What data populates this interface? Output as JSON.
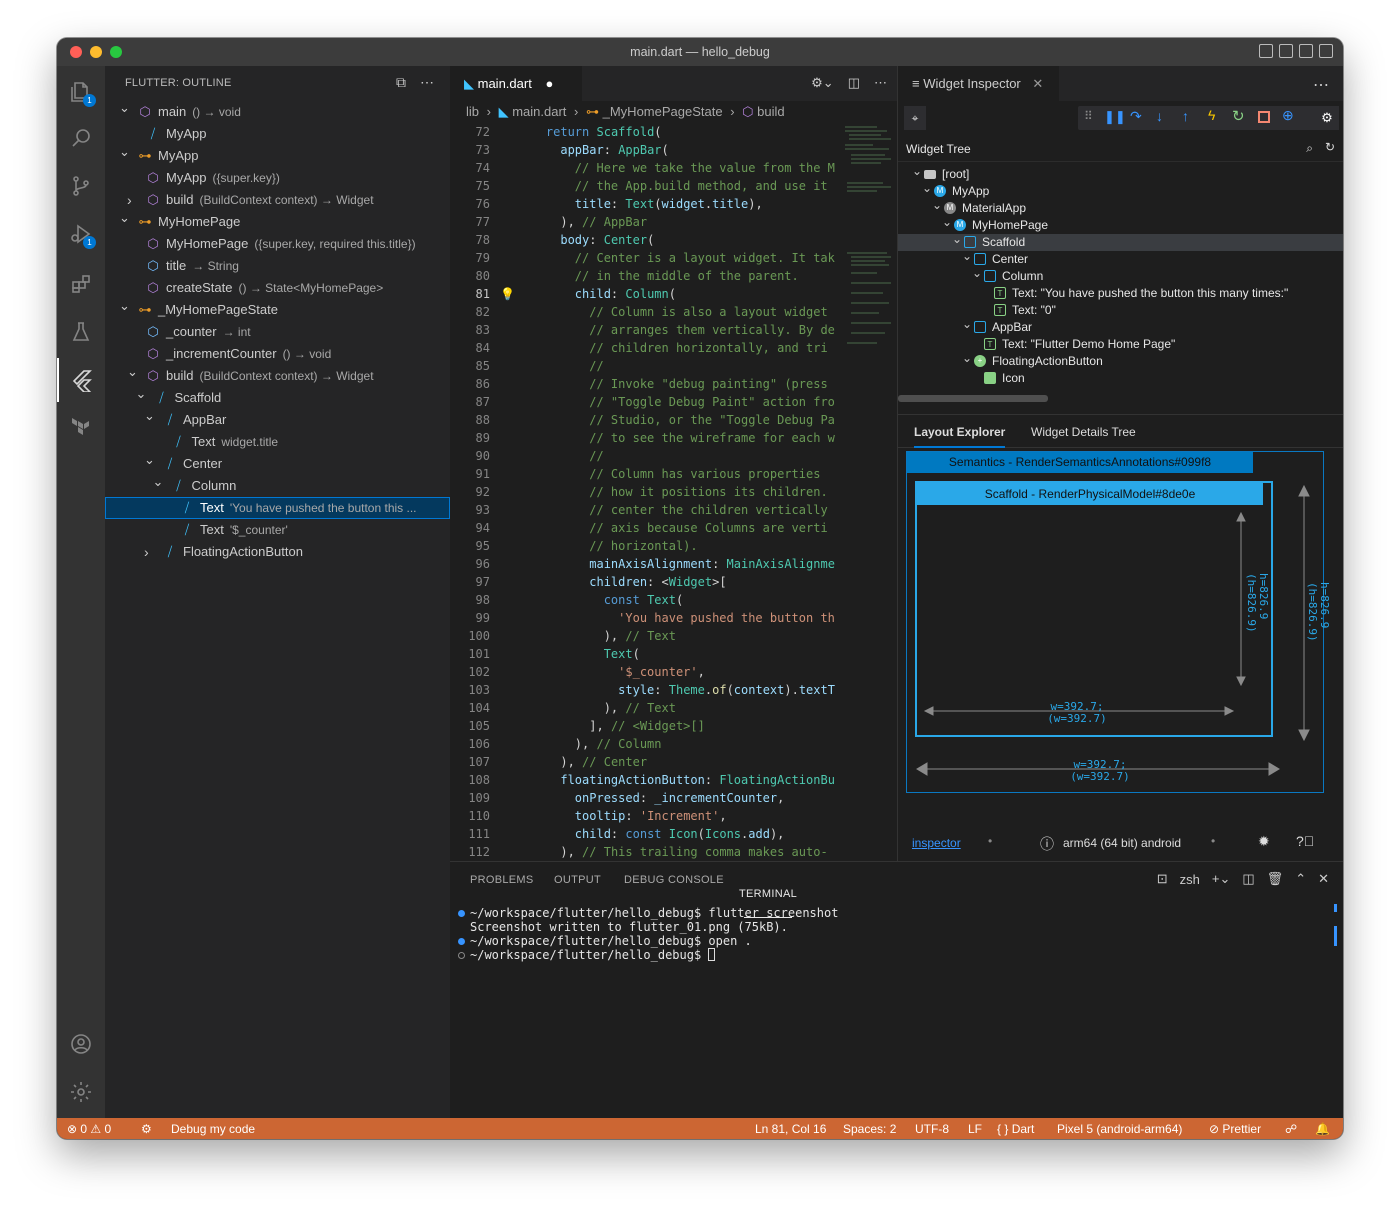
{
  "window": {
    "title": "main.dart — hello_debug"
  },
  "activity": {
    "explorer_badge": "1",
    "debug_badge": "1"
  },
  "outline": {
    "header": "FLUTTER: OUTLINE",
    "rows": [
      {
        "label": "main",
        "detail": "() → void"
      },
      {
        "label": "MyApp",
        "detail": ""
      },
      {
        "label": "MyApp",
        "detail": ""
      },
      {
        "label": "MyApp",
        "detail": "({super.key})"
      },
      {
        "label": "build",
        "detail": "(BuildContext context) → Widget"
      },
      {
        "label": "MyHomePage",
        "detail": ""
      },
      {
        "label": "MyHomePage",
        "detail": "({super.key, required this.title})"
      },
      {
        "label": "title",
        "detail": "→ String"
      },
      {
        "label": "createState",
        "detail": "() → State<MyHomePage>"
      },
      {
        "label": "_MyHomePageState",
        "detail": ""
      },
      {
        "label": "_counter",
        "detail": "→ int"
      },
      {
        "label": "_incrementCounter",
        "detail": "() → void"
      },
      {
        "label": "build",
        "detail": "(BuildContext context) → Widget"
      },
      {
        "label": "Scaffold",
        "detail": ""
      },
      {
        "label": "AppBar",
        "detail": ""
      },
      {
        "label": "Text",
        "detail": "widget.title"
      },
      {
        "label": "Center",
        "detail": ""
      },
      {
        "label": "Column",
        "detail": ""
      },
      {
        "label": "Text",
        "detail": "'You have pushed the button this ..."
      },
      {
        "label": "Text",
        "detail": "'$_counter'"
      },
      {
        "label": "FloatingActionButton",
        "detail": ""
      }
    ]
  },
  "editor": {
    "tab": "main.dart",
    "breadcrumb": {
      "a": "lib",
      "b": "main.dart",
      "c": "_MyHomePageState",
      "d": "build"
    },
    "lines": [
      {
        "n": "72",
        "t": "    return Scaffold("
      },
      {
        "n": "73",
        "t": "      appBar: AppBar("
      },
      {
        "n": "74",
        "t": "        // Here we take the value from the M"
      },
      {
        "n": "75",
        "t": "        // the App.build method, and use it"
      },
      {
        "n": "76",
        "t": "        title: Text(widget.title),"
      },
      {
        "n": "77",
        "t": "      ), // AppBar"
      },
      {
        "n": "78",
        "t": "      body: Center("
      },
      {
        "n": "79",
        "t": "        // Center is a layout widget. It tak"
      },
      {
        "n": "80",
        "t": "        // in the middle of the parent."
      },
      {
        "n": "81",
        "t": "        child: Column("
      },
      {
        "n": "82",
        "t": "          // Column is also a layout widget"
      },
      {
        "n": "83",
        "t": "          // arranges them vertically. By de"
      },
      {
        "n": "84",
        "t": "          // children horizontally, and tri"
      },
      {
        "n": "85",
        "t": "          //"
      },
      {
        "n": "86",
        "t": "          // Invoke \"debug painting\" (press"
      },
      {
        "n": "87",
        "t": "          // \"Toggle Debug Paint\" action fro"
      },
      {
        "n": "88",
        "t": "          // Studio, or the \"Toggle Debug Pa"
      },
      {
        "n": "89",
        "t": "          // to see the wireframe for each w"
      },
      {
        "n": "90",
        "t": "          //"
      },
      {
        "n": "91",
        "t": "          // Column has various properties"
      },
      {
        "n": "92",
        "t": "          // how it positions its children."
      },
      {
        "n": "93",
        "t": "          // center the children vertically"
      },
      {
        "n": "94",
        "t": "          // axis because Columns are verti"
      },
      {
        "n": "95",
        "t": "          // horizontal)."
      },
      {
        "n": "96",
        "t": "          mainAxisAlignment: MainAxisAlignme"
      },
      {
        "n": "97",
        "t": "          children: <Widget>["
      },
      {
        "n": "98",
        "t": "            const Text("
      },
      {
        "n": "99",
        "t": "              'You have pushed the button th"
      },
      {
        "n": "100",
        "t": "            ), // Text"
      },
      {
        "n": "101",
        "t": "            Text("
      },
      {
        "n": "102",
        "t": "              '$_counter',"
      },
      {
        "n": "103",
        "t": "              style: Theme.of(context).textT"
      },
      {
        "n": "104",
        "t": "            ), // Text"
      },
      {
        "n": "105",
        "t": "          ], // <Widget>[]"
      },
      {
        "n": "106",
        "t": "        ), // Column"
      },
      {
        "n": "107",
        "t": "      ), // Center"
      },
      {
        "n": "108",
        "t": "      floatingActionButton: FloatingActionBu"
      },
      {
        "n": "109",
        "t": "        onPressed: _incrementCounter,"
      },
      {
        "n": "110",
        "t": "        tooltip: 'Increment',"
      },
      {
        "n": "111",
        "t": "        child: const Icon(Icons.add),"
      },
      {
        "n": "112",
        "t": "      ), // This trailing comma makes auto-"
      }
    ]
  },
  "inspector": {
    "tab": "Widget Inspector",
    "tree_title": "Widget Tree",
    "tree": [
      {
        "label": "[root]"
      },
      {
        "label": "MyApp"
      },
      {
        "label": "MaterialApp"
      },
      {
        "label": "MyHomePage"
      },
      {
        "label": "Scaffold"
      },
      {
        "label": "Center"
      },
      {
        "label": "Column"
      },
      {
        "label": "Text: \"You have pushed the button this many times:\""
      },
      {
        "label": "Text: \"0\""
      },
      {
        "label": "AppBar"
      },
      {
        "label": "Text: \"Flutter Demo Home Page\""
      },
      {
        "label": "FloatingActionButton"
      },
      {
        "label": "Icon"
      }
    ],
    "tabs": {
      "layout": "Layout Explorer",
      "details": "Widget Details Tree"
    },
    "semantics_label": "Semantics - RenderSemanticsAnnotations#099f8",
    "scaffold_label": "Scaffold - RenderPhysicalModel#8de0e",
    "inner_h": "h=826.9",
    "inner_h2": "(h=826.9)",
    "inner_w": "w=392.7;",
    "inner_w2": "(w=392.7)",
    "outer_h": "h=826.9",
    "outer_h2": "(h=826.9)",
    "outer_w": "w=392.7;",
    "outer_w2": "(w=392.7)",
    "footer": {
      "link": "inspector",
      "device": "arm64 (64 bit) android"
    }
  },
  "panel": {
    "tabs": [
      "PROBLEMS",
      "OUTPUT",
      "DEBUG CONSOLE",
      "TERMINAL"
    ],
    "shell": "zsh",
    "terminal": [
      "~/workspace/flutter/hello_debug$ flutter screenshot",
      "Screenshot written to flutter_01.png (75kB).",
      "~/workspace/flutter/hello_debug$ open .",
      "~/workspace/flutter/hello_debug$ "
    ]
  },
  "statusbar": {
    "errors": "0",
    "warnings": "0",
    "debug": "Debug my code",
    "cursor": "Ln 81, Col 16",
    "spaces": "Spaces: 2",
    "encoding": "UTF-8",
    "eol": "LF",
    "lang": "Dart",
    "device": "Pixel 5 (android-arm64)",
    "prettier": "Prettier"
  },
  "colors": {
    "status_bg": "#cc6633",
    "accent": "#0078d4",
    "selection": "#04395e"
  }
}
